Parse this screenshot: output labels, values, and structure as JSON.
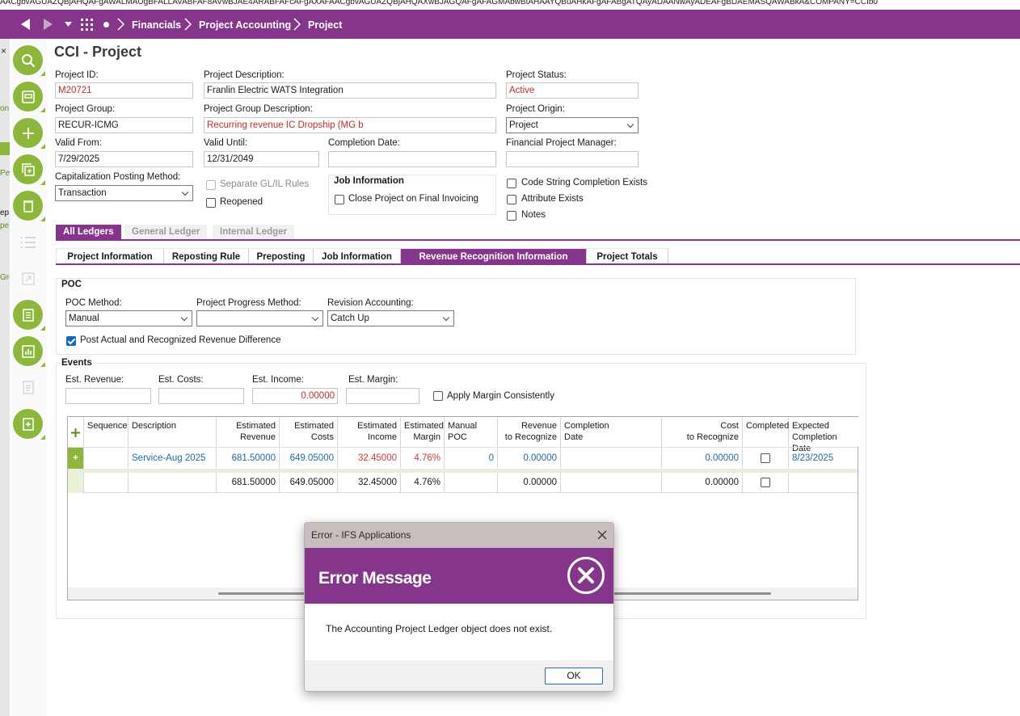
{
  "url_fragment": "AACgbvAGUAZQBjAHQAFgAWALMAUgBFALLAVABFAF8AVwBJAE4ARABFAFcAFgAXAFAACgbvAGUAZQBjAHQAXwBJAGQAFgAFAGMAbwBtAHAAYQBuAHkAFgAFABgATQAyADAANwAyADEAFgBDAEMASQAWABkA&COMPANY=CCIb0",
  "nav": {
    "breadcrumbs": [
      "Financials",
      "Project Accounting",
      "Project"
    ]
  },
  "rail_edge_text": {
    "a": "on",
    "b": "Per",
    "c": "ep",
    "d": "pe",
    "e": "Gro"
  },
  "page": {
    "title": "CCI - Project"
  },
  "form": {
    "project_id_label": "Project ID:",
    "project_id": "M20721",
    "project_desc_label": "Project Description:",
    "project_desc": "Franlin Electric WATS Integration",
    "project_status_label": "Project Status:",
    "project_status": "Active",
    "project_group_label": "Project Group:",
    "project_group": "RECUR-ICMG",
    "project_group_desc_label": "Project Group Description:",
    "project_group_desc": "Recurring revenue IC Dropship (MG b",
    "project_origin_label": "Project Origin:",
    "project_origin": "Project",
    "valid_from_label": "Valid From:",
    "valid_from": "7/29/2025",
    "valid_until_label": "Valid Until:",
    "valid_until": "12/31/2049",
    "completion_date_label": "Completion Date:",
    "completion_date": "",
    "fin_pm_label": "Financial Project Manager:",
    "fin_pm": "",
    "cap_method_label": "Capitalization Posting Method:",
    "cap_method": "Transaction",
    "separate_gl_label": "Separate GL/IL Rules",
    "reopened_label": "Reopened",
    "job_info_title": "Job Information",
    "close_on_final_label": "Close Project on Final Invoicing",
    "code_string_label": "Code String Completion Exists",
    "attribute_label": "Attribute Exists",
    "notes_label": "Notes"
  },
  "ledger_tabs": [
    "All Ledgers",
    "General Ledger",
    "Internal Ledger"
  ],
  "sub_tabs": [
    "Project Information",
    "Reposting Rule",
    "Preposting",
    "Job Information",
    "Revenue Recognition Information",
    "Project Totals"
  ],
  "poc": {
    "title": "POC",
    "method_label": "POC Method:",
    "method": "Manual",
    "progress_label": "Project Progress Method:",
    "progress": "",
    "revision_label": "Revision Accounting:",
    "revision": "Catch Up",
    "post_actual_label": "Post Actual and Recognized Revenue Difference"
  },
  "events": {
    "title": "Events",
    "est_revenue_label": "Est. Revenue:",
    "est_revenue": "",
    "est_costs_label": "Est. Costs:",
    "est_costs": "",
    "est_income_label": "Est. Income:",
    "est_income": "0.00000",
    "est_margin_label": "Est. Margin:",
    "est_margin": "",
    "apply_margin_label": "Apply Margin Consistently"
  },
  "grid": {
    "headers": {
      "sequence": "Sequence",
      "description": "Description",
      "est_revenue": [
        "Estimated",
        "Revenue"
      ],
      "est_costs": [
        "Estimated",
        "Costs"
      ],
      "est_income": [
        "Estimated",
        "Income"
      ],
      "est_margin": [
        "Estimated",
        "Margin"
      ],
      "manual_poc": "Manual POC",
      "rev_to_recognize": [
        "Revenue",
        "to Recognize"
      ],
      "completion_date": [
        "Completion",
        "Date"
      ],
      "cost_to_recognize": [
        "Cost",
        "to Recognize"
      ],
      "completed": "Completed",
      "expected_completion": [
        "Expected",
        "Completion Date"
      ]
    },
    "row": {
      "sequence": "",
      "description": "Service-Aug 2025",
      "est_revenue": "681.50000",
      "est_costs": "649.05000",
      "est_income": "32.45000",
      "est_margin": "4.76%",
      "manual_poc": "0",
      "rev_to_recognize": "0.00000",
      "completion_date": "",
      "cost_to_recognize": "0.00000",
      "expected_completion": "8/23/2025"
    },
    "totals": {
      "est_revenue": "681.50000",
      "est_costs": "649.05000",
      "est_income": "32.45000",
      "est_margin": "4.76%",
      "rev_to_recognize": "0.00000",
      "cost_to_recognize": "0.00000"
    }
  },
  "dialog": {
    "title": "Error - IFS Applications",
    "heading": "Error Message",
    "message": "The Accounting Project Ledger object does not exist.",
    "ok": "OK"
  },
  "colors": {
    "brand_purple": "#86368a",
    "rail_green": "#8cb63c",
    "error_red": "#c42b2b",
    "link_blue": "#1f6aa5"
  }
}
